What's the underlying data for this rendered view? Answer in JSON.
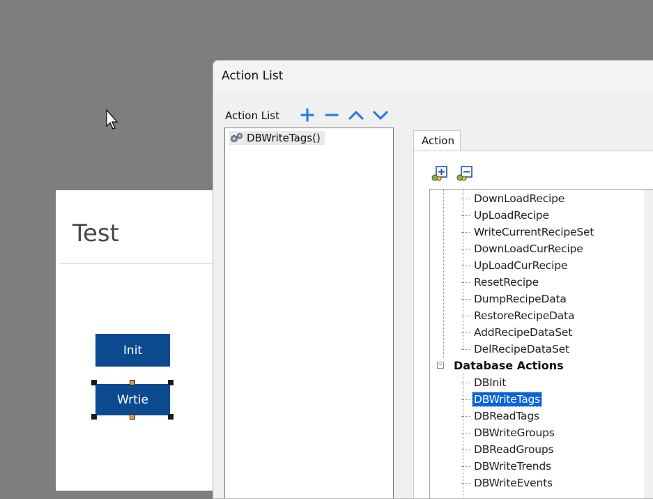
{
  "canvas": {
    "page_title": "Test",
    "init_label": "Init",
    "write_label": "Wrtie"
  },
  "dialog": {
    "title": "Action List",
    "list_label": "Action List",
    "toolbar_icons": [
      "plus-icon",
      "minus-icon",
      "chevron-up-icon",
      "chevron-down-icon"
    ],
    "list_items": [
      "DBWriteTags()"
    ],
    "tab_label": "Action",
    "tree_toolbar_icons": [
      "add-action-icon",
      "remove-action-icon"
    ],
    "tree_items": [
      "DownLoadRecipe",
      "UpLoadRecipe",
      "WriteCurrentRecipeSet",
      "DownLoadCurRecipe",
      "UpLoadCurRecipe",
      "ResetRecipe",
      "DumpRecipeData",
      "RestoreRecipeData",
      "AddRecipeDataSet",
      "DelRecipeDataSet"
    ],
    "tree_group": "Database Actions",
    "tree_group_items": [
      "DBInit",
      "DBWriteTags",
      "DBReadTags",
      "DBWriteGroups",
      "DBReadGroups",
      "DBWriteTrends",
      "DBWriteEvents"
    ],
    "selected_item": "DBWriteTags"
  },
  "colors": {
    "accent": "#2b7be0",
    "hmi_button": "#0b4a8f",
    "selection": "#0a64d8"
  }
}
